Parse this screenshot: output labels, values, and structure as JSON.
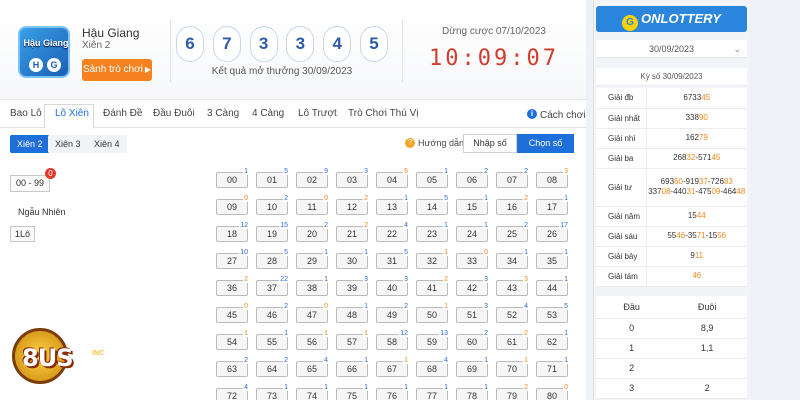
{
  "header": {
    "lottery_name": "Hậu Giang",
    "lottery_type": "Xiên 2",
    "logo_text": "Hậu Giang",
    "logo_balls": [
      "H",
      "G"
    ],
    "play_button": "Sảnh trò chơi",
    "result_balls": [
      "6",
      "7",
      "3",
      "3",
      "4",
      "5"
    ],
    "draw_date_text": "Kết quả mở thưởng 30/09/2023",
    "next_draw_text": "Dừng cược 07/10/2023",
    "countdown": "10:09:07"
  },
  "tabs": [
    {
      "label": "Bao Lô"
    },
    {
      "label": "Lô Xiên"
    },
    {
      "label": "Đánh Đề"
    },
    {
      "label": "Đầu Đuôi"
    },
    {
      "label": "3 Càng"
    },
    {
      "label": "4 Càng"
    },
    {
      "label": "Lô Trượt"
    },
    {
      "label": "Trò Chơi Thú Vị"
    }
  ],
  "guide_link": "Cách chơi",
  "subtabs": [
    "Xiên 2",
    "Xiên 3",
    "Xiên 4"
  ],
  "howto_label": "Hướng dẫn",
  "mode_input": "Nhập số",
  "mode_quick": "Chọn số nhanh",
  "range_button": "00 - 99",
  "range_badge": "0",
  "random_label": "Ngẫu Nhiên",
  "one_button": "1Lô",
  "numbers": [
    {
      "n": "00",
      "c": "1",
      "o": false
    },
    {
      "n": "01",
      "c": "5",
      "o": false
    },
    {
      "n": "02",
      "c": "9",
      "o": false
    },
    {
      "n": "03",
      "c": "3",
      "o": false
    },
    {
      "n": "04",
      "c": "6",
      "o": true
    },
    {
      "n": "05",
      "c": "1",
      "o": false
    },
    {
      "n": "06",
      "c": "2",
      "o": false
    },
    {
      "n": "07",
      "c": "2",
      "o": false
    },
    {
      "n": "08",
      "c": "3",
      "o": true
    },
    {
      "n": "09",
      "c": "0",
      "o": true
    },
    {
      "n": "10",
      "c": "2",
      "o": false
    },
    {
      "n": "11",
      "c": "0",
      "o": true
    },
    {
      "n": "12",
      "c": "2",
      "o": true
    },
    {
      "n": "13",
      "c": "1",
      "o": false
    },
    {
      "n": "14",
      "c": "5",
      "o": false
    },
    {
      "n": "15",
      "c": "1",
      "o": false
    },
    {
      "n": "16",
      "c": "2",
      "o": true
    },
    {
      "n": "17",
      "c": "1",
      "o": false
    },
    {
      "n": "18",
      "c": "12",
      "o": false
    },
    {
      "n": "19",
      "c": "15",
      "o": false
    },
    {
      "n": "20",
      "c": "2",
      "o": false
    },
    {
      "n": "21",
      "c": "2",
      "o": true
    },
    {
      "n": "22",
      "c": "4",
      "o": false
    },
    {
      "n": "23",
      "c": "1",
      "o": false
    },
    {
      "n": "24",
      "c": "1",
      "o": false
    },
    {
      "n": "25",
      "c": "2",
      "o": false
    },
    {
      "n": "26",
      "c": "17",
      "o": false
    },
    {
      "n": "27",
      "c": "10",
      "o": false
    },
    {
      "n": "28",
      "c": "5",
      "o": false
    },
    {
      "n": "29",
      "c": "1",
      "o": false
    },
    {
      "n": "30",
      "c": "1",
      "o": false
    },
    {
      "n": "31",
      "c": "5",
      "o": false
    },
    {
      "n": "32",
      "c": "1",
      "o": true
    },
    {
      "n": "33",
      "c": "0",
      "o": true
    },
    {
      "n": "34",
      "c": "1",
      "o": false
    },
    {
      "n": "35",
      "c": "1",
      "o": false
    },
    {
      "n": "36",
      "c": "2",
      "o": true
    },
    {
      "n": "37",
      "c": "22",
      "o": false
    },
    {
      "n": "38",
      "c": "1",
      "o": false
    },
    {
      "n": "39",
      "c": "3",
      "o": false
    },
    {
      "n": "40",
      "c": "3",
      "o": false
    },
    {
      "n": "41",
      "c": "2",
      "o": true
    },
    {
      "n": "42",
      "c": "3",
      "o": false
    },
    {
      "n": "43",
      "c": "3",
      "o": true
    },
    {
      "n": "44",
      "c": "1",
      "o": false
    },
    {
      "n": "45",
      "c": "0",
      "o": true
    },
    {
      "n": "46",
      "c": "2",
      "o": false
    },
    {
      "n": "47",
      "c": "0",
      "o": true
    },
    {
      "n": "48",
      "c": "1",
      "o": false
    },
    {
      "n": "49",
      "c": "2",
      "o": false
    },
    {
      "n": "50",
      "c": "1",
      "o": true
    },
    {
      "n": "51",
      "c": "3",
      "o": false
    },
    {
      "n": "52",
      "c": "4",
      "o": false
    },
    {
      "n": "53",
      "c": "5",
      "o": false
    },
    {
      "n": "54",
      "c": "1",
      "o": true
    },
    {
      "n": "55",
      "c": "1",
      "o": false
    },
    {
      "n": "56",
      "c": "1",
      "o": true
    },
    {
      "n": "57",
      "c": "1",
      "o": true
    },
    {
      "n": "58",
      "c": "12",
      "o": false
    },
    {
      "n": "59",
      "c": "13",
      "o": false
    },
    {
      "n": "60",
      "c": "2",
      "o": false
    },
    {
      "n": "61",
      "c": "2",
      "o": true
    },
    {
      "n": "62",
      "c": "1",
      "o": false
    },
    {
      "n": "63",
      "c": "2",
      "o": false
    },
    {
      "n": "64",
      "c": "2",
      "o": false
    },
    {
      "n": "65",
      "c": "4",
      "o": false
    },
    {
      "n": "66",
      "c": "1",
      "o": false
    },
    {
      "n": "67",
      "c": "1",
      "o": true
    },
    {
      "n": "68",
      "c": "4",
      "o": false
    },
    {
      "n": "69",
      "c": "1",
      "o": false
    },
    {
      "n": "70",
      "c": "1",
      "o": true
    },
    {
      "n": "71",
      "c": "1",
      "o": false
    },
    {
      "n": "72",
      "c": "4",
      "o": false
    },
    {
      "n": "73",
      "c": "1",
      "o": false
    },
    {
      "n": "74",
      "c": "1",
      "o": false
    },
    {
      "n": "75",
      "c": "1",
      "o": false
    },
    {
      "n": "76",
      "c": "1",
      "o": false
    },
    {
      "n": "77",
      "c": "1",
      "o": false
    },
    {
      "n": "78",
      "c": "1",
      "o": false
    },
    {
      "n": "79",
      "c": "2",
      "o": true
    },
    {
      "n": "80",
      "c": "0",
      "o": true
    }
  ],
  "mascot_text": "8US",
  "mascot_sub": "INC",
  "side": {
    "brand": "ONLOTTERY",
    "date": "30/09/2023",
    "ky_so": "Kỳ số 30/09/2023",
    "prizes": [
      {
        "name": "Giải đb",
        "value": "673345"
      },
      {
        "name": "Giải nhất",
        "value": "33890"
      },
      {
        "name": "Giải nhì",
        "value": "16279"
      },
      {
        "name": "Giải ba",
        "value": "26832-57145"
      },
      {
        "name": "Giải tư",
        "value": "69360-91937-72683 33708-44031-47509-46448"
      },
      {
        "name": "Giải năm",
        "value": "1544"
      },
      {
        "name": "Giải sáu",
        "value": "5546-3571-1556"
      },
      {
        "name": "Giải bảy",
        "value": "911"
      },
      {
        "name": "Giải tám",
        "value": "46"
      }
    ],
    "head_label": "Đầu",
    "tail_label": "Đuôi",
    "head_tail_rows": [
      {
        "head": "0",
        "tail": "8,9"
      },
      {
        "head": "1",
        "tail": "1,1"
      },
      {
        "head": "2",
        "tail": ""
      },
      {
        "head": "3",
        "tail": "2"
      }
    ]
  },
  "colors": {
    "accent_blue": "#1e6fd9",
    "orange": "#f6821f",
    "countdown_red": "#d23c2c",
    "brand_blue": "#2a86dd"
  }
}
